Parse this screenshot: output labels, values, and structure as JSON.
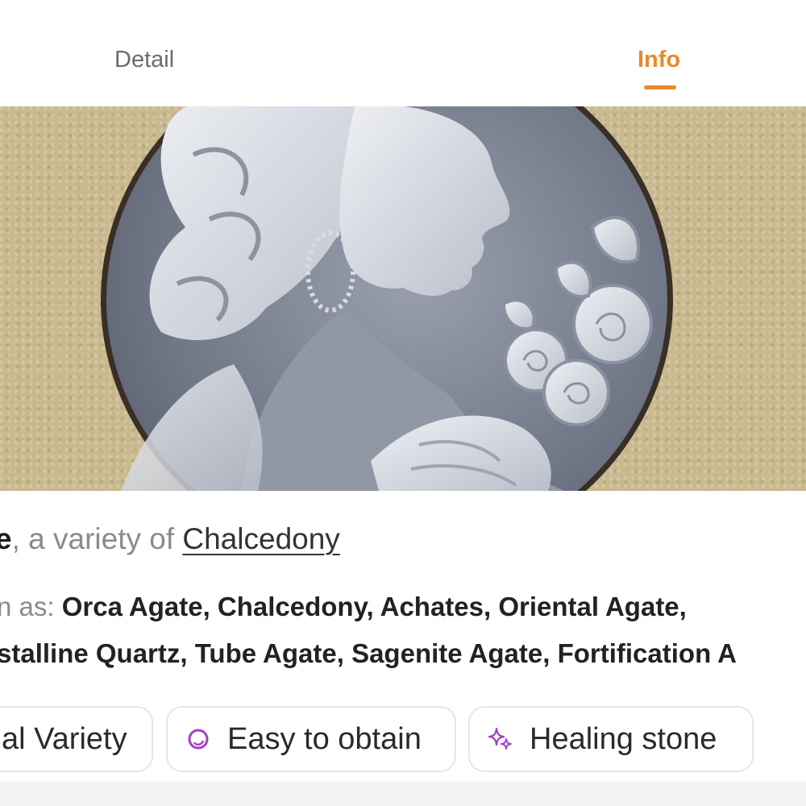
{
  "tabs": {
    "detail": "Detail",
    "info": "Info",
    "active": "Info",
    "active_color": "#e8892c"
  },
  "hero": {
    "image_alt": "Carved agate cameo of a woman's profile with roses"
  },
  "title": {
    "strong": "e",
    "prefix": ", a variety of ",
    "link": "Chalcedony"
  },
  "aka": {
    "line1_prefix": "n as: ",
    "line1_names": "Orca Agate, Chalcedony, Achates, Oriental Agate,",
    "line2_names": "stalline Quartz, Tube Agate, Sagenite Agate, Fortification A"
  },
  "chips": [
    {
      "label": "al Variety",
      "icon": ""
    },
    {
      "label": "Easy to obtain",
      "icon": "ring-icon"
    },
    {
      "label": "Healing stone",
      "icon": "sparkle-icon"
    }
  ],
  "colors": {
    "accent": "#e8892c",
    "chip_icon": "#a93cc7",
    "background": "#ffffff"
  }
}
